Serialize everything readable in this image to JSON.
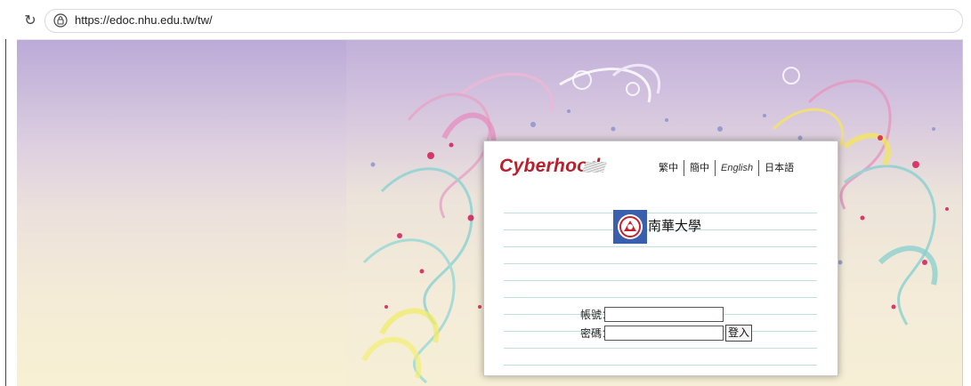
{
  "browser": {
    "url": "https://edoc.nhu.edu.tw/tw/",
    "reload_icon": "reload-icon",
    "lock_icon": "site-info-icon"
  },
  "login": {
    "brand": "Cyberhood",
    "languages": [
      "繁中",
      "簡中",
      "English",
      "日本語"
    ],
    "school_name": "南華大學",
    "account_label": "帳號：",
    "password_label": "密碼：",
    "account_value": "",
    "password_value": "",
    "submit_label": "登入"
  },
  "colors": {
    "brand_red": "#b8202c",
    "row_line": "#bfe0dc",
    "logo_blue": "#3a5fae"
  }
}
